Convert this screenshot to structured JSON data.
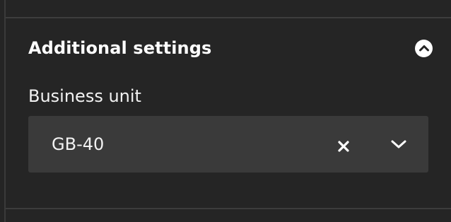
{
  "section": {
    "title": "Additional settings",
    "collapse_icon": "chevron-up-circle-icon"
  },
  "business_unit": {
    "label": "Business unit",
    "value": "GB-40",
    "clear_icon": "close-icon",
    "dropdown_icon": "chevron-down-icon"
  },
  "colors": {
    "background": "#252525",
    "field_background": "#3a3a3a",
    "text": "#ffffff",
    "divider": "#3d3d3d"
  }
}
